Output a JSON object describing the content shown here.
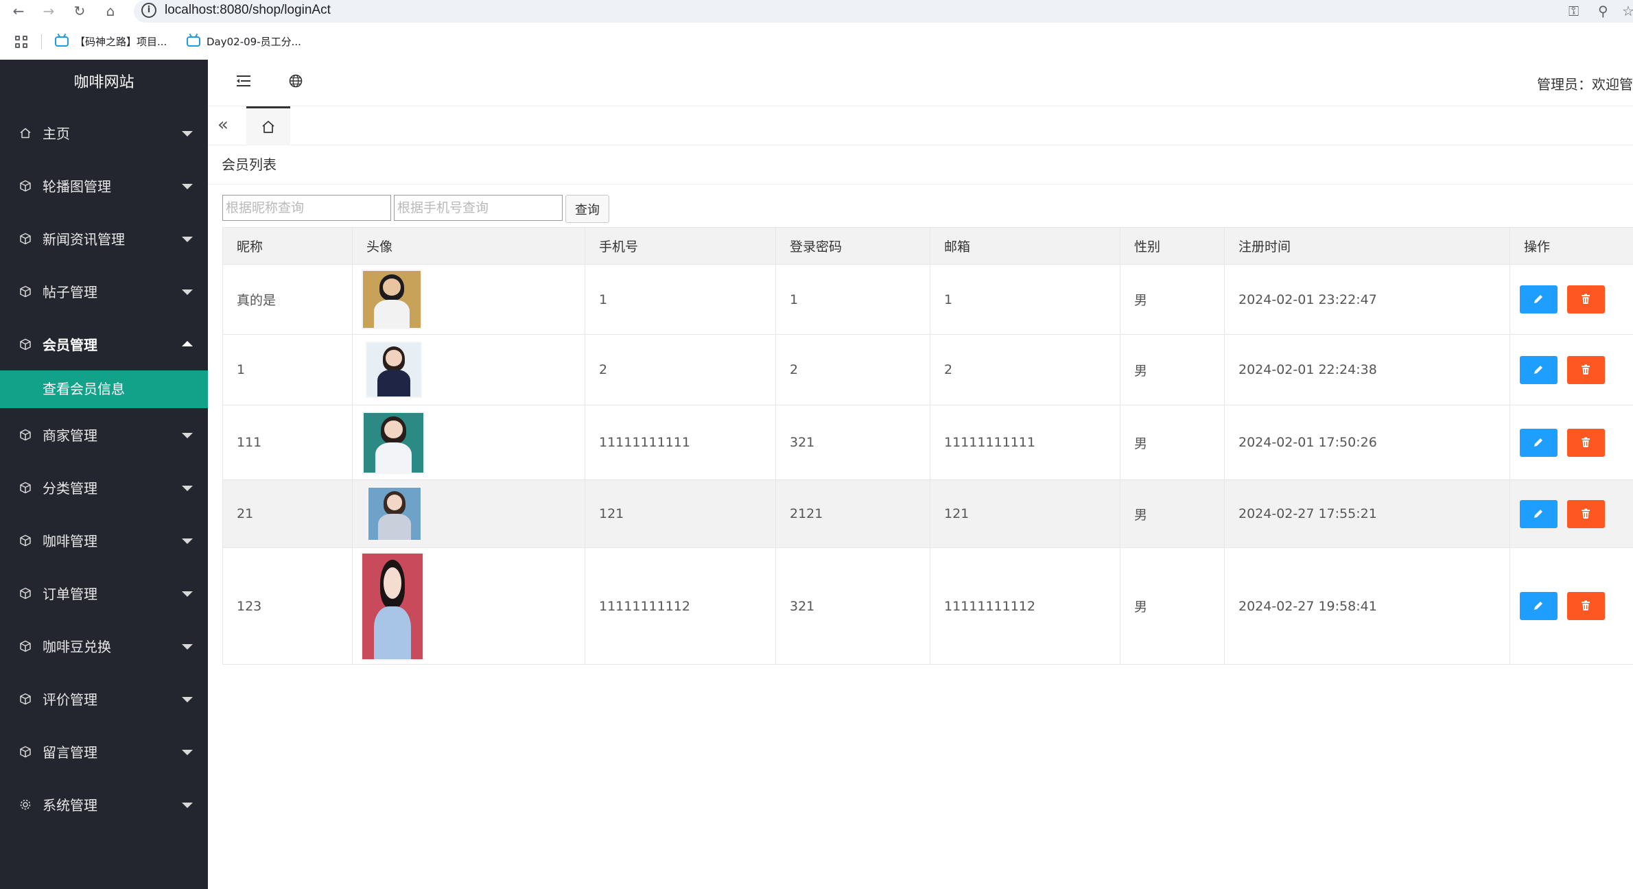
{
  "browser": {
    "url": "localhost:8080/shop/loginAct",
    "bookmarks": [
      "【码神之路】项目...",
      "Day02-09-员工分..."
    ]
  },
  "sidebar": {
    "title": "咖啡网站",
    "items": [
      {
        "label": "主页",
        "icon": "home-icon"
      },
      {
        "label": "轮播图管理",
        "icon": "cube-icon"
      },
      {
        "label": "新闻资讯管理",
        "icon": "cube-icon"
      },
      {
        "label": "帖子管理",
        "icon": "cube-icon"
      },
      {
        "label": "会员管理",
        "icon": "cube-icon",
        "open": true
      },
      {
        "label": "商家管理",
        "icon": "cube-icon"
      },
      {
        "label": "分类管理",
        "icon": "cube-icon"
      },
      {
        "label": "咖啡管理",
        "icon": "cube-icon"
      },
      {
        "label": "订单管理",
        "icon": "cube-icon"
      },
      {
        "label": "咖啡豆兑换",
        "icon": "cube-icon"
      },
      {
        "label": "评价管理",
        "icon": "cube-icon"
      },
      {
        "label": "留言管理",
        "icon": "cube-icon"
      },
      {
        "label": "系统管理",
        "icon": "gear-icon"
      }
    ],
    "submenu": {
      "active_label": "查看会员信息"
    }
  },
  "header": {
    "admin_text": "管理员：欢迎管"
  },
  "page": {
    "title": "会员列表",
    "search": {
      "nickname_placeholder": "根据昵称查询",
      "phone_placeholder": "根据手机号查询",
      "button_label": "查询"
    }
  },
  "table": {
    "headers": [
      "昵称",
      "头像",
      "手机号",
      "登录密码",
      "邮箱",
      "性别",
      "注册时间",
      "操作"
    ],
    "rows": [
      {
        "nickname": "真的是",
        "phone": "1",
        "password": "1",
        "email": "1",
        "gender": "男",
        "registered": "2024-02-01 23:22:47"
      },
      {
        "nickname": "1",
        "phone": "2",
        "password": "2",
        "email": "2",
        "gender": "男",
        "registered": "2024-02-01 22:24:38"
      },
      {
        "nickname": "111",
        "phone": "11111111111",
        "password": "321",
        "email": "11111111111",
        "gender": "男",
        "registered": "2024-02-01 17:50:26"
      },
      {
        "nickname": "21",
        "phone": "121",
        "password": "2121",
        "email": "121",
        "gender": "男",
        "registered": "2024-02-27 17:55:21"
      },
      {
        "nickname": "123",
        "phone": "11111111112",
        "password": "321",
        "email": "11111111112",
        "gender": "男",
        "registered": "2024-02-27 19:58:41"
      }
    ]
  },
  "colors": {
    "sidebar_bg": "#23262e",
    "active_submenu": "#12a289",
    "edit_button": "#1e9fff",
    "delete_button": "#ff5722"
  }
}
